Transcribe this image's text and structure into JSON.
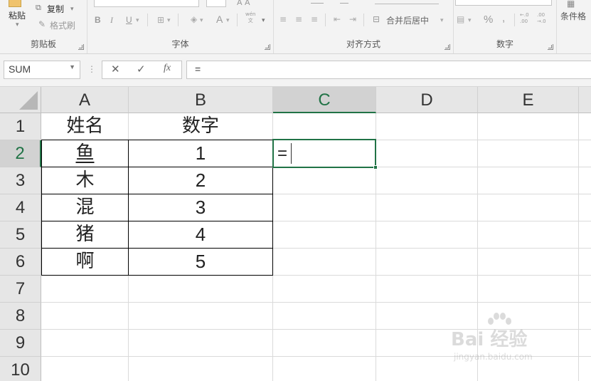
{
  "ribbon": {
    "clipboard": {
      "paste_label": "粘贴",
      "copy_label": "复制",
      "format_painter_label": "格式刷",
      "group_label": "剪贴板"
    },
    "font": {
      "bold": "B",
      "italic": "I",
      "underline": "U",
      "font_color_glyph": "A",
      "phonetic_glyph": "wén\n文",
      "group_label": "字体"
    },
    "alignment": {
      "merge_center_label": "合并后居中",
      "group_label": "对齐方式"
    },
    "number": {
      "percent": "%",
      "comma": ",",
      "inc_decimal": "←.0\n.00",
      "dec_decimal": ".00\n→.0",
      "group_label": "数字"
    },
    "styles": {
      "conditional_format_label": "条件格"
    }
  },
  "formula_bar": {
    "name_box": "SUM",
    "cancel_glyph": "✕",
    "enter_glyph": "✓",
    "fx_glyph": "fx",
    "content": "="
  },
  "sheet": {
    "columns": [
      "A",
      "B",
      "C",
      "D",
      "E"
    ],
    "rows": [
      "1",
      "2",
      "3",
      "4",
      "5",
      "6",
      "7",
      "8",
      "9",
      "10"
    ],
    "selected_column": "C",
    "selected_row": "2",
    "header_row": {
      "a": "姓名",
      "b": "数字"
    },
    "data_rows": [
      {
        "a": "鱼",
        "b": "1"
      },
      {
        "a": "木",
        "b": "2"
      },
      {
        "a": "混",
        "b": "3"
      },
      {
        "a": "猪",
        "b": "4"
      },
      {
        "a": "啊",
        "b": "5"
      }
    ],
    "active_cell_text": "="
  },
  "watermark": {
    "main": "Bai 经验",
    "sub": "jingyan.baidu.com"
  },
  "colors": {
    "accent_green": "#217346",
    "header_bg": "#e6e6e6",
    "ribbon_bg": "#f3f3f3"
  }
}
